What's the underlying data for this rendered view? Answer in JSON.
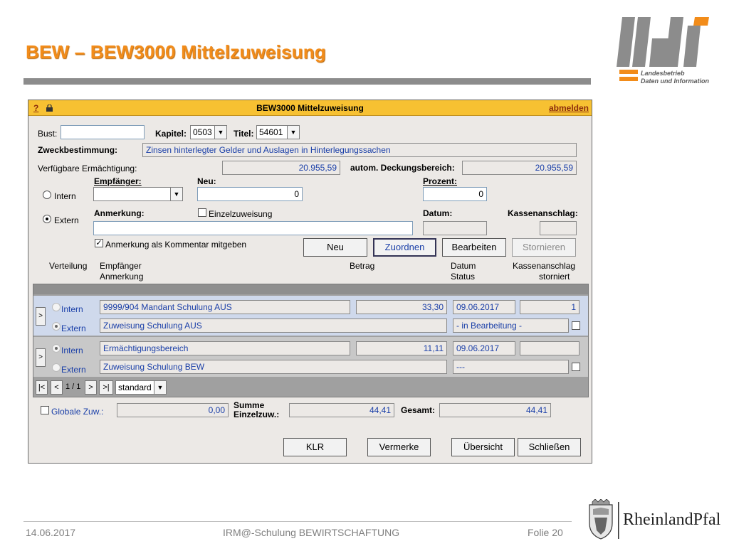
{
  "slide": {
    "title": "BEW – BEW3000 Mittelzuweisung",
    "footer_date": "14.06.2017",
    "footer_center": "IRM@-Schulung BEWIRTSCHAFTUNG",
    "footer_page": "Folie 20",
    "ldi_logo_line1": "Landesbetrieb",
    "ldi_logo_line2": "Daten und Information",
    "rlp_logo_text": "RheinlandPfalz"
  },
  "app": {
    "help": "?",
    "title": "BEW3000 Mittelzuweisung",
    "logout": "abmelden",
    "bust_label": "Bust:",
    "bust_value": "",
    "kapitel_label": "Kapitel:",
    "kapitel_value": "0503",
    "titel_label": "Titel:",
    "titel_value": "54601",
    "zweck_label": "Zweckbestimmung:",
    "zweck_value": "Zinsen hinterlegter Gelder und Auslagen in Hinterlegungssachen",
    "verf_label": "Verfügbare Ermächtigung:",
    "verf_value": "20.955,59",
    "autom_label": "autom. Deckungsbereich:",
    "autom_value": "20.955,59",
    "empf_label": "Empfänger:",
    "neu_label": "Neu:",
    "neu_value": "0",
    "prozent_label": "Prozent:",
    "prozent_value": "0",
    "intern_label": "Intern",
    "extern_label": "Extern",
    "anm_label": "Anmerkung:",
    "einzel_label": "Einzelzuweisung",
    "datum_label": "Datum:",
    "kassen_label": "Kassenanschlag:",
    "anm_kommentar_label": "Anmerkung als Kommentar mitgeben",
    "buttons": {
      "neu": "Neu",
      "zuordnen": "Zuordnen",
      "bearbeiten": "Bearbeiten",
      "stornieren": "Stornieren"
    },
    "columns": {
      "verteilung": "Verteilung",
      "empfaenger": "Empfänger",
      "anmerkung": "Anmerkung",
      "betrag": "Betrag",
      "datum": "Datum",
      "status": "Status",
      "kassenanschlag": "Kassenanschlag",
      "storniert": "storniert"
    },
    "rows": [
      {
        "intern_label": "Intern",
        "extern_label": "Extern",
        "empfaenger": "9999/904 Mandant Schulung AUS",
        "betrag": "33,30",
        "datum": "09.06.2017",
        "kassenanschlag": "1",
        "anmerkung": "Zuweisung Schulung AUS",
        "status": "- in Bearbeitung -"
      },
      {
        "intern_label": "Intern",
        "extern_label": "Extern",
        "empfaenger": "Ermächtigungsbereich",
        "betrag": "11,11",
        "datum": "09.06.2017",
        "kassenanschlag": "",
        "anmerkung": "Zuweisung Schulung BEW",
        "status": "---"
      }
    ],
    "pager": {
      "first": "|<",
      "prev": "<",
      "page": "1 / 1",
      "next": ">",
      "last": ">|",
      "view": "standard"
    },
    "globale_label": "Globale Zuw.:",
    "globale_value": "0,00",
    "summe_label_1": "Summe",
    "summe_label_2": "Einzelzuw.:",
    "summe_value": "44,41",
    "gesamt_label": "Gesamt:",
    "gesamt_value": "44,41",
    "bottom_buttons": {
      "klr": "KLR",
      "vermerke": "Vermerke",
      "uebersicht": "Übersicht",
      "schliessen": "Schließen"
    }
  },
  "colors": {
    "title_orange": "#f28c1a",
    "titlebar_yellow": "#f7c132",
    "field_blue": "#1a3fa8",
    "logo_gray": "#8c8c8c"
  }
}
